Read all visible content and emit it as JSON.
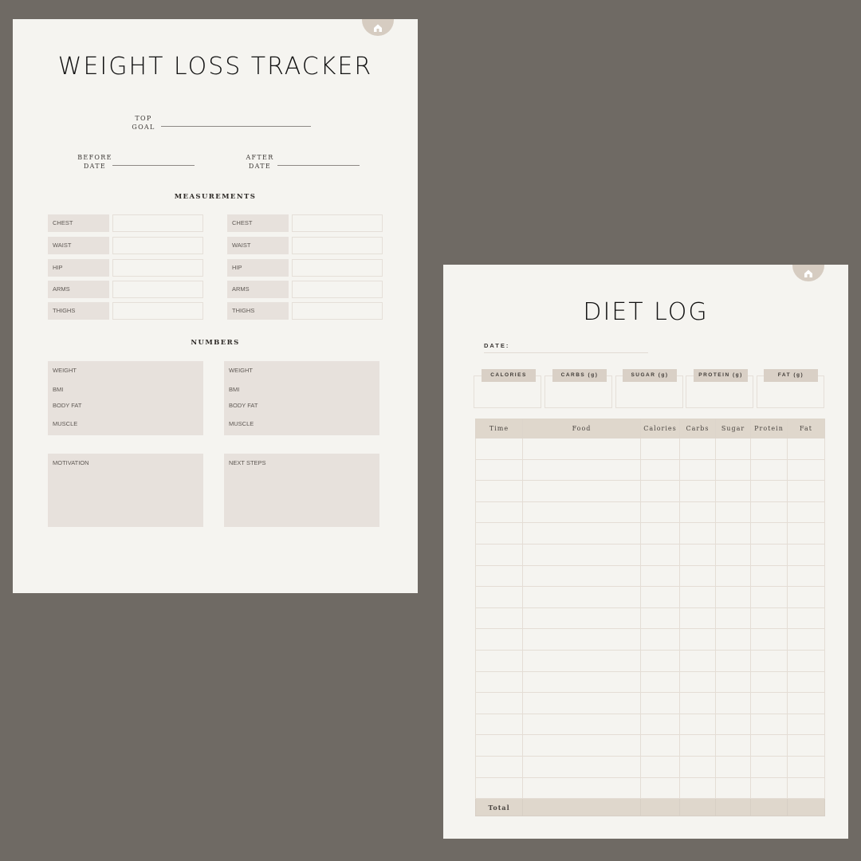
{
  "weight_tracker": {
    "title": "WEIGHT LOSS TRACKER",
    "home_icon": "home-icon",
    "top_goal": {
      "line1": "TOP",
      "line2": "GOAL",
      "value": ""
    },
    "before_date": {
      "line1": "BEFORE",
      "line2": "DATE",
      "value": ""
    },
    "after_date": {
      "line1": "AFTER",
      "line2": "DATE",
      "value": ""
    },
    "measurements_heading": "MEASUREMENTS",
    "measurements_left": [
      "CHEST",
      "WAIST",
      "HIP",
      "ARMS",
      "THIGHS"
    ],
    "measurements_right": [
      "CHEST",
      "WAIST",
      "HIP",
      "ARMS",
      "THIGHS"
    ],
    "numbers_heading": "NUMBERS",
    "numbers_left": [
      "WEIGHT",
      "BMI",
      "BODY FAT",
      "MUSCLE"
    ],
    "numbers_right": [
      "WEIGHT",
      "BMI",
      "BODY FAT",
      "MUSCLE"
    ],
    "motivation_label": "MOTIVATION",
    "next_steps_label": "NEXT STEPS"
  },
  "diet_log": {
    "title": "DIET LOG",
    "home_icon": "home-icon",
    "date_label": "DATE:",
    "macro_cards": [
      "CALORIES",
      "CARBS (g)",
      "SUGAR (g)",
      "PROTEIN (g)",
      "FAT (g)"
    ],
    "table": {
      "columns": [
        "Time",
        "Food",
        "Calories",
        "Carbs",
        "Sugar",
        "Protein",
        "Fat"
      ],
      "row_count": 17,
      "total_label": "Total"
    }
  },
  "colors": {
    "background": "#6f6a64",
    "paper": "#f5f4f0",
    "accent": "#d9d0c6",
    "label_fill": "#e7e1dc"
  }
}
